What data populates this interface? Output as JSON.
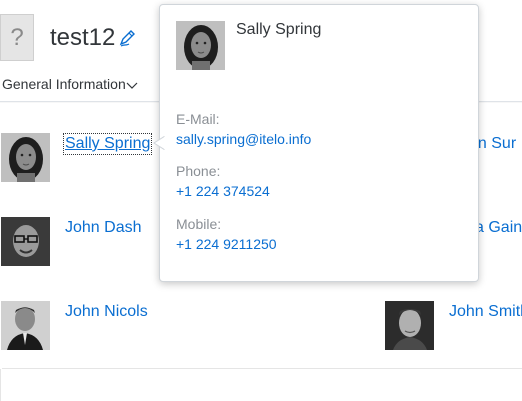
{
  "header": {
    "placeholder_image_glyph": "?",
    "object_title": "test12",
    "edit_icon": "edit-icon",
    "tab_label": "General Information",
    "tab_icon": "chevron-down-icon"
  },
  "employees": [
    {
      "name": "Sally Spring",
      "avatar": "woman-portrait"
    },
    {
      "name": "John Dash",
      "avatar": "man-glasses-portrait"
    },
    {
      "name": "John Nicols",
      "avatar": "man-suit-portrait"
    },
    {
      "name": "an Sur",
      "avatar": "hidden"
    },
    {
      "name": "a Gain",
      "avatar": "hidden"
    },
    {
      "name": "John Smith",
      "avatar": "man-portrait"
    }
  ],
  "popover": {
    "name": "Sally Spring",
    "email_label": "E-Mail:",
    "email": "sally.spring@itelo.info",
    "phone_label": "Phone:",
    "phone": "+1 224 374524",
    "mobile_label": "Mobile:",
    "mobile": "+1 224 9211250"
  },
  "colors": {
    "link": "#0a6ed1",
    "text": "#32363a",
    "label": "#8a8f95"
  }
}
